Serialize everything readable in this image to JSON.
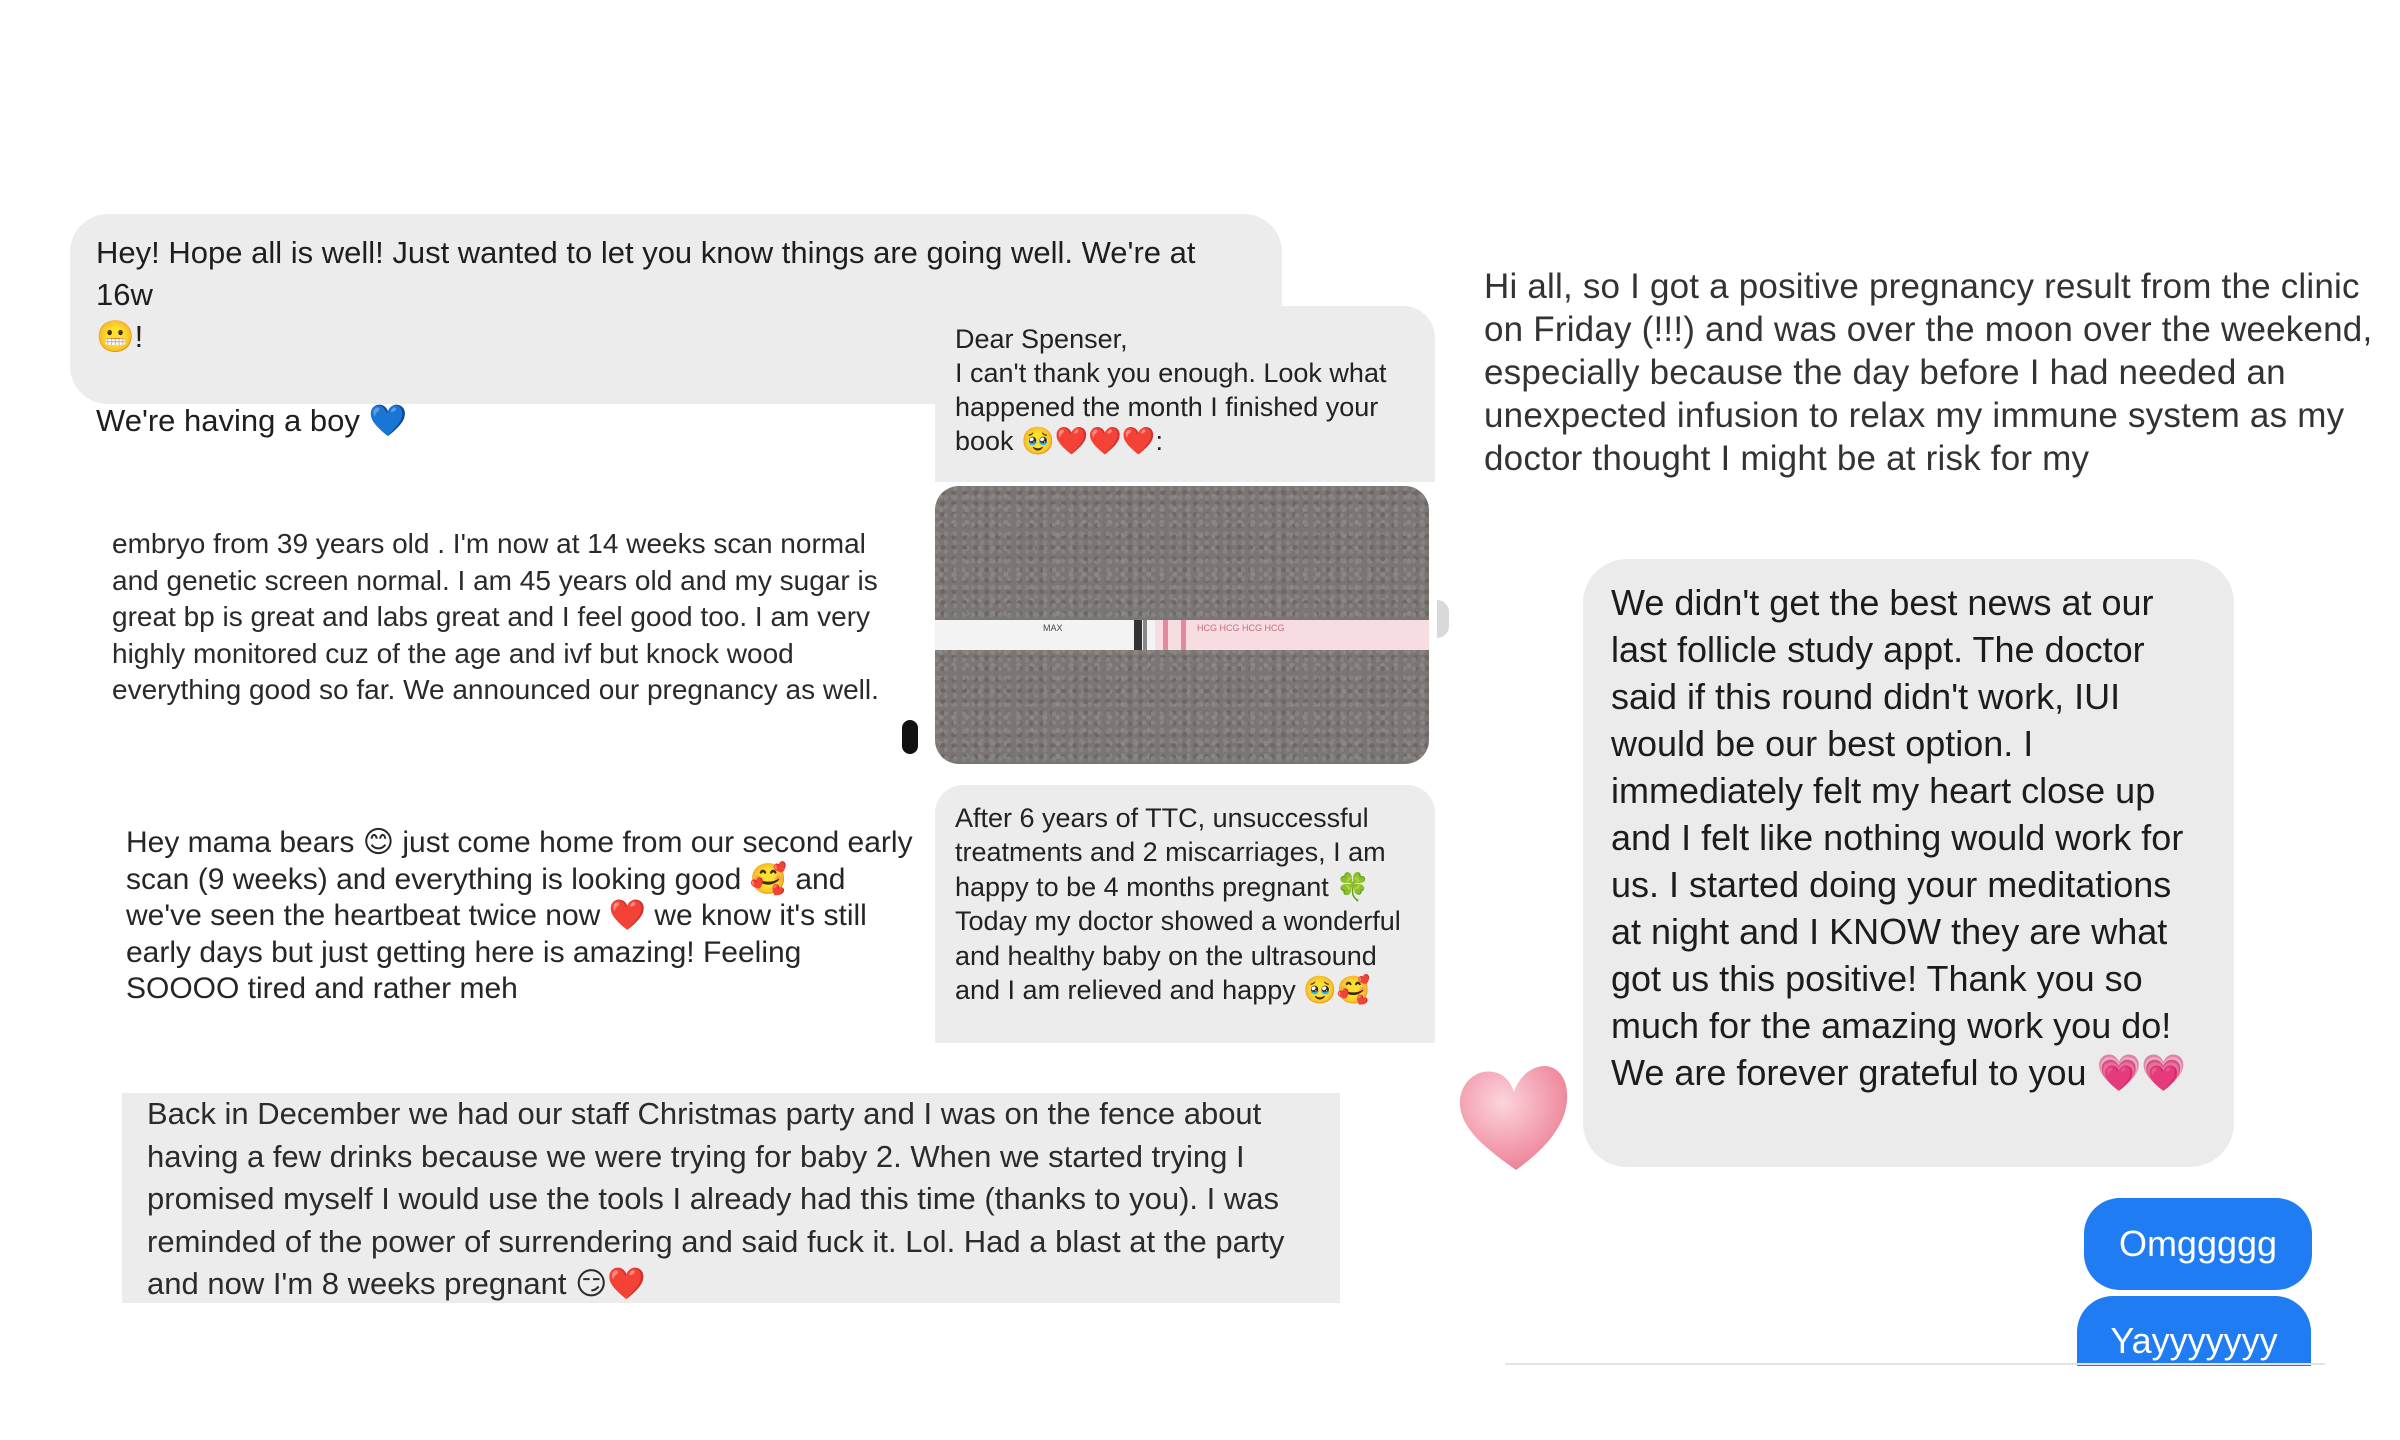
{
  "bubble1": {
    "line1": "Hey! Hope all is well! Just wanted to let you know things are going well. We're at 16w",
    "line2": "😬!",
    "line3": "We're having a boy 💙"
  },
  "bubble2": {
    "greeting": "Dear Spenser,",
    "body": "I can't thank you enough. Look what happened the month I finished your book 🥹❤️❤️❤️:"
  },
  "photo": {
    "strip_mark": "MAX",
    "strip_print": "HCG HCG HCG HCG"
  },
  "text_embryo": "embryo from 39 years old .  I'm now at 14 weeks scan normal and genetic screen normal.  I am 45 years old and my sugar is great bp is great and labs great and I feel good too.  I am very highly monitored cuz of the age and ivf but knock wood everything good so far.  We announced our pregnancy as well.",
  "bubble3": "After 6 years of TTC, unsuccessful treatments and 2 miscarriages, I am happy to be 4 months pregnant 🍀 Today my doctor showed a wonderful and healthy baby on the ultrasound and I am relieved and happy 🥹🥰",
  "text_mama": "Hey mama bears 😊 just come home from our second early scan (9 weeks) and everything is looking good 🥰 and we've seen the heartbeat twice now ❤️ we know it's still early days but just getting here is amazing! Feeling SOOOO tired and rather meh",
  "bubble4": "Back in December we had our staff Christmas party and I was on the fence about having a few drinks because we were trying for baby 2. When we started trying I promised myself I would use the tools I already had this time (thanks to you). I was reminded of the power of surrendering and said fuck it. Lol. Had a blast at the party and now I'm 8 weeks pregnant 😏❤️",
  "text_hi_all": "Hi all, so I got a positive pregnancy result from the clinic on Friday (!!!) and was over the moon over the weekend, especially because the day before I had needed an unexpected  infusion to relax my immune system as my doctor thought I might be at risk for my",
  "imessage": {
    "received": "We didn't get the best news at our last follicle study appt. The doctor said if this round didn't work, IUI would be our best option. I immediately felt my heart close up and I felt like nothing would work for us. I started doing your meditations at night and I KNOW they are what got us this positive! Thank you so much for the amazing work you do! We are forever grateful to you 💗💗",
    "sent1": "Omggggg",
    "sent2": "Yayyyyyyy"
  },
  "colors": {
    "fb_bubble": "#ececec",
    "imessage_blue": "#1f7cf2",
    "heart_pink": "#f08aa0"
  }
}
